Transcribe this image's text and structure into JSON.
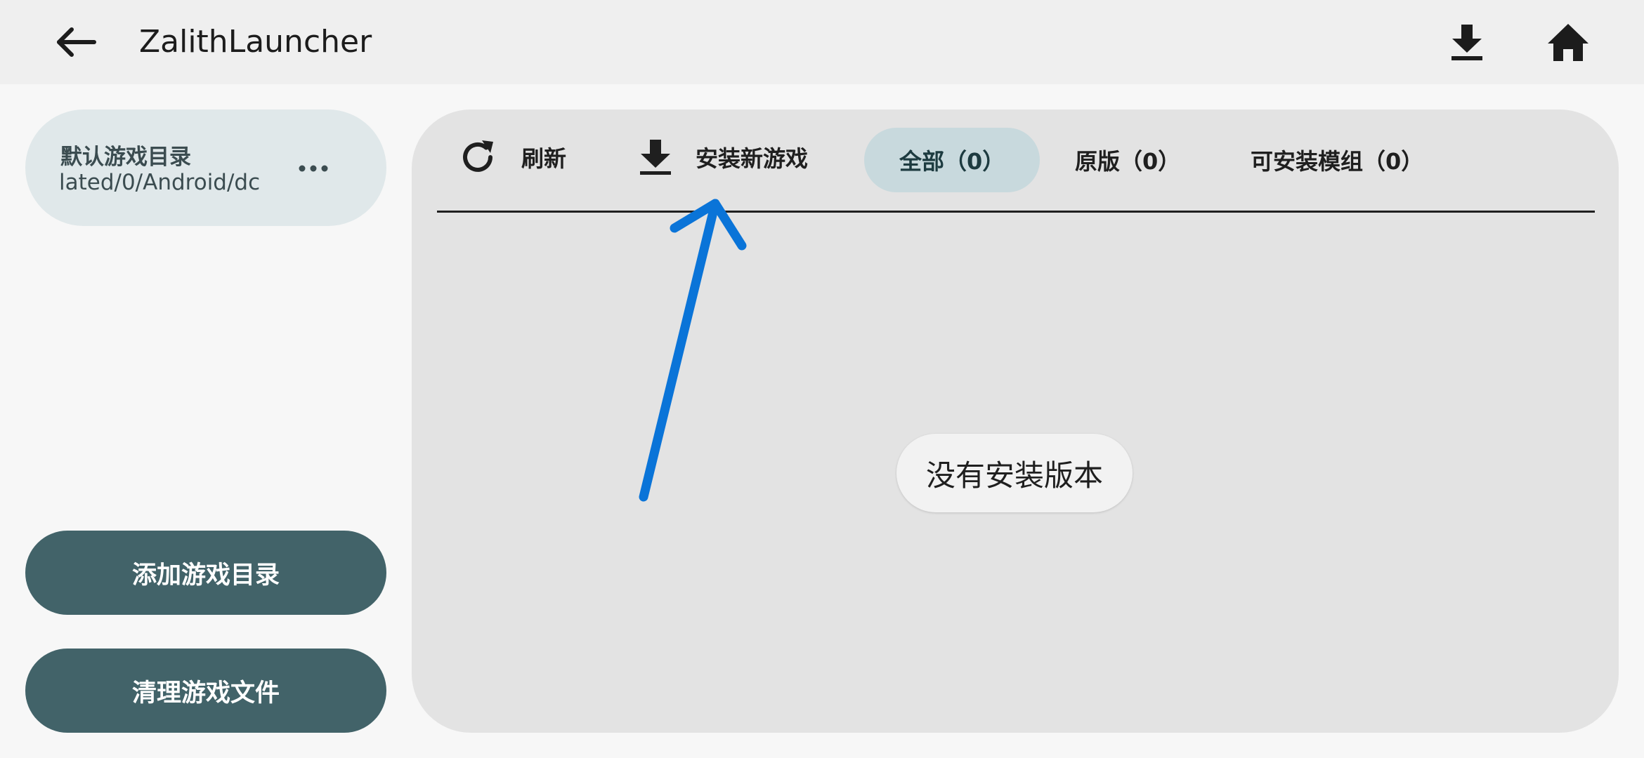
{
  "header": {
    "title": "ZalithLauncher",
    "back_icon": "back-arrow-icon",
    "download_icon": "download-icon",
    "home_icon": "home-icon"
  },
  "sidebar": {
    "directory": {
      "name": "默认游戏目录",
      "path": "lated/0/Android/dc",
      "more_icon": "more-horizontal-icon"
    },
    "add_button_label": "添加游戏目录",
    "clean_button_label": "清理游戏文件"
  },
  "toolbar": {
    "refresh_label": "刷新",
    "install_label": "安装新游戏",
    "tabs": [
      {
        "label": "全部（0）",
        "selected": true
      },
      {
        "label": "原版（0）",
        "selected": false
      },
      {
        "label": "可安装模组（0）",
        "selected": false
      }
    ]
  },
  "main": {
    "empty_message": "没有安装版本"
  },
  "colors": {
    "accent_button": "#426369",
    "selected_tab": "#c8d9dd",
    "annotation_arrow": "#0a74d8"
  }
}
